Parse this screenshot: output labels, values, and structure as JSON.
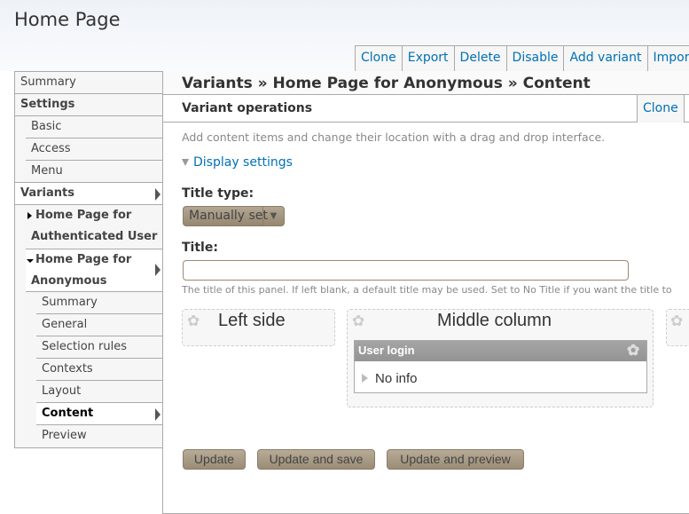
{
  "page_title": "Home Page",
  "top_tabs": [
    "Clone",
    "Export",
    "Delete",
    "Disable",
    "Add variant",
    "Import v"
  ],
  "sidebar": {
    "items": [
      {
        "label": "Summary"
      },
      {
        "label": "Settings"
      },
      {
        "label": "Basic"
      },
      {
        "label": "Access"
      },
      {
        "label": "Menu"
      },
      {
        "label": "Variants"
      },
      {
        "label": "Home Page for Authenticated User"
      },
      {
        "label": "Home Page for Anonymous"
      },
      {
        "label": "Summary"
      },
      {
        "label": "General"
      },
      {
        "label": "Selection rules"
      },
      {
        "label": "Contexts"
      },
      {
        "label": "Layout"
      },
      {
        "label": "Content"
      },
      {
        "label": "Preview"
      }
    ]
  },
  "main": {
    "breadcrumb": "Variants » Home Page for Anonymous » Content",
    "operations_title": "Variant operations",
    "operations_clone": "Clone",
    "description": "Add content items and change their location with a drag and drop interface.",
    "display_settings": "Display settings",
    "title_type_label": "Title type:",
    "title_type_value": "Manually set",
    "title_label": "Title:",
    "title_value": "",
    "title_help": "The title of this panel. If left blank, a default title may be used. Set to No Title if you want the title to",
    "regions": {
      "left": "Left side",
      "middle": "Middle column"
    },
    "pane": {
      "title": "User login",
      "body": "No info"
    },
    "buttons": {
      "update": "Update",
      "update_save": "Update and save",
      "update_preview": "Update and preview"
    }
  }
}
